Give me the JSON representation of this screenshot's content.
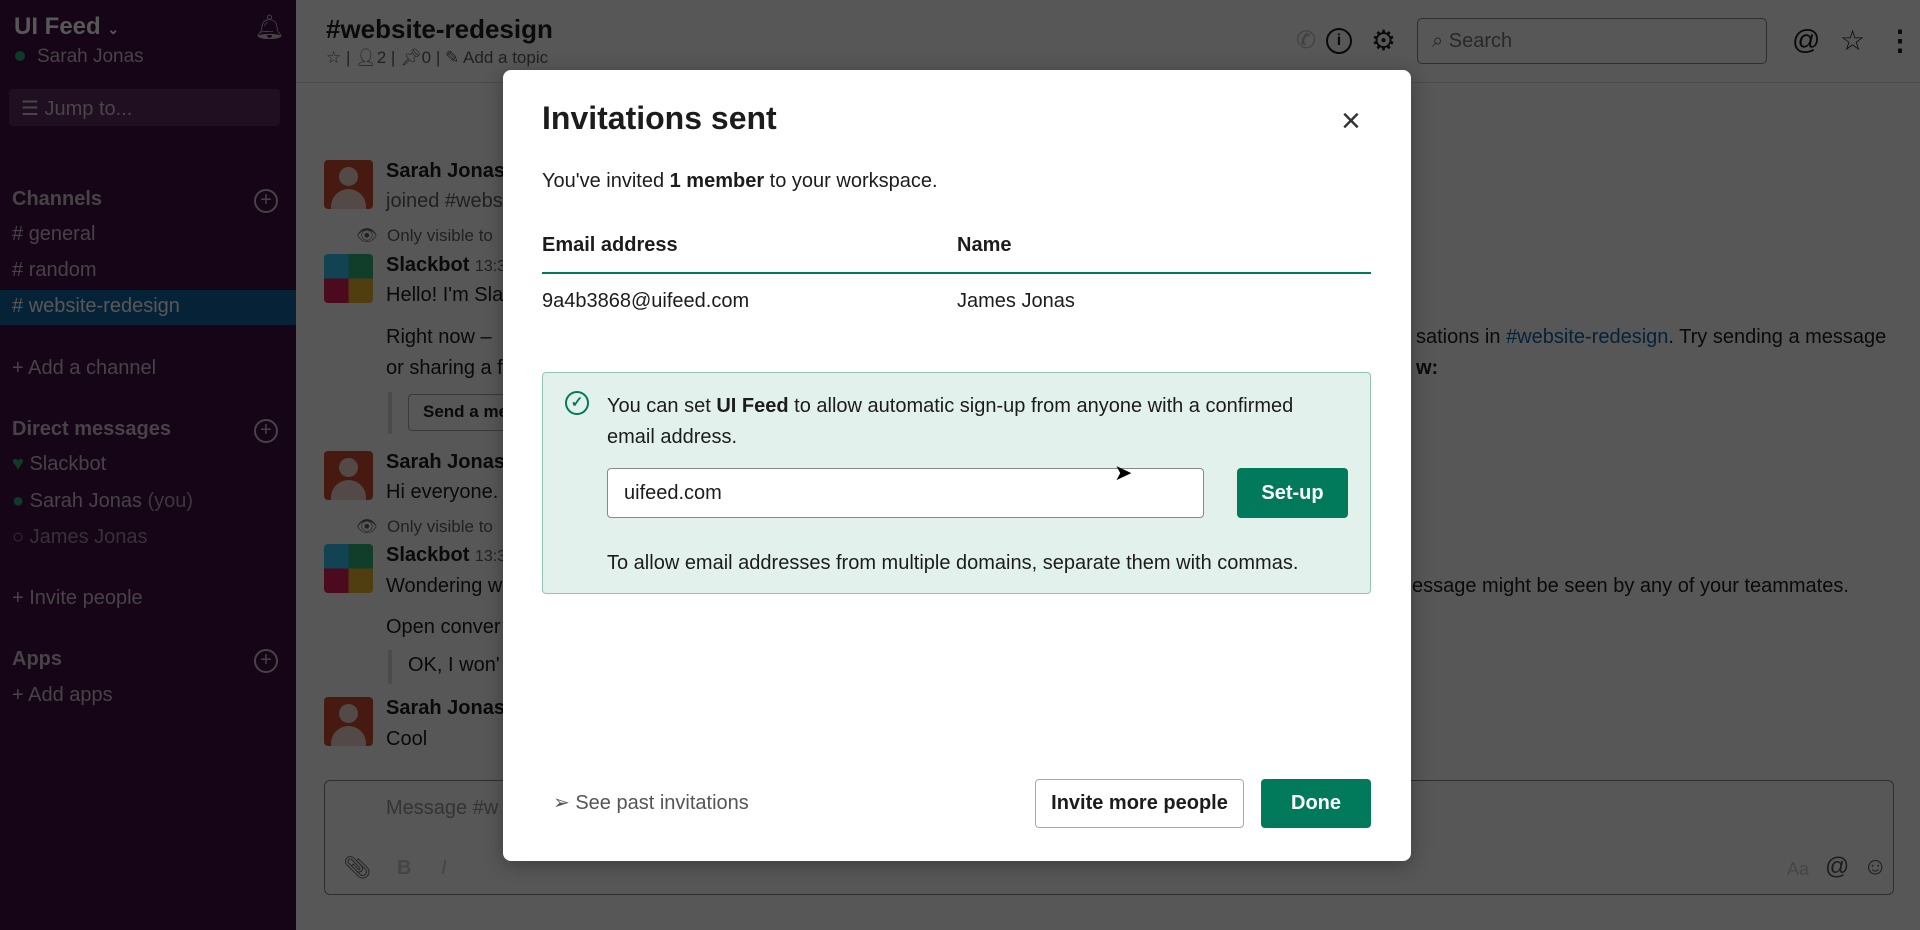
{
  "sidebar": {
    "workspace": "UI Feed",
    "user": "Sarah Jonas",
    "jump_placeholder": "Jump to...",
    "channels_label": "Channels",
    "channels": [
      "general",
      "random",
      "website-redesign"
    ],
    "add_channel": "Add a channel",
    "dm_label": "Direct messages",
    "dms": [
      {
        "name": "Slackbot"
      },
      {
        "name": "Sarah Jonas",
        "suffix": "(you)"
      },
      {
        "name": "James Jonas"
      }
    ],
    "invite": "Invite people",
    "apps_label": "Apps",
    "add_apps": "Add apps"
  },
  "header": {
    "channel": "#website-redesign",
    "members": "2",
    "pins": "0",
    "topic": "Add a topic",
    "search_placeholder": "Search"
  },
  "messages": {
    "m1_name": "Sarah Jonas",
    "m1_text": "joined #webs",
    "only1": "Only visible to",
    "m2_name": "Slackbot",
    "m2_time": "13:3",
    "m2_text": "Hello! I'm Sla",
    "m2_p1": "Right now – ",
    "m2_p1_right": "sations in ",
    "m2_link": "#website-redesign",
    "m2_p1_end": ". Try sending a message",
    "m2_p2": "or sharing a f",
    "m2_p2_right": "w:",
    "m2_btn": "Send a me",
    "m3_name": "Sarah Jonas",
    "m3_text": "Hi everyone.",
    "only2": "Only visible to",
    "m4_name": "Slackbot",
    "m4_time": "13:3",
    "m4_text": "Wondering w",
    "m4_right": "essage might be seen by any of your teammates.",
    "m4_p2": "Open conver",
    "m4_quote": "OK, I won'",
    "m5_name": "Sarah Jonas",
    "m5_text": "Cool",
    "composer_placeholder": "Message #w",
    "composer_aa": "Aa"
  },
  "modal": {
    "title": "Invitations sent",
    "intro_pre": "You've invited ",
    "intro_bold": "1 member",
    "intro_post": " to your workspace.",
    "col_email": "Email address",
    "col_name": "Name",
    "rows": [
      {
        "email": "9a4b3868@uifeed.com",
        "name": "James Jonas"
      }
    ],
    "notice_pre": "You can set ",
    "notice_bold": "UI Feed",
    "notice_post": " to allow automatic sign-up from anyone with a confirmed",
    "notice_line2": "email address.",
    "domain_value": "uifeed.com",
    "setup": "Set-up",
    "help": "To allow email addresses from multiple domains, separate them with commas.",
    "past": "See past invitations",
    "invite_more": "Invite more people",
    "done": "Done"
  },
  "colors": {
    "accent": "#007a5a",
    "sidebar": "#3f0e40",
    "active": "#1164a3",
    "notice_bg": "#e3f1ec"
  }
}
